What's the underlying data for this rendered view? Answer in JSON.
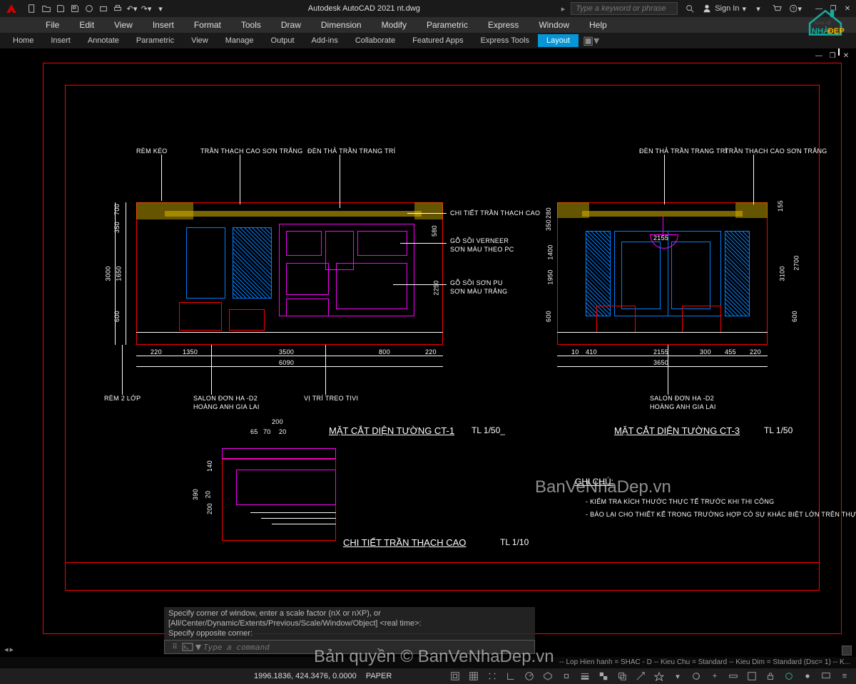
{
  "app": {
    "title": "Autodesk AutoCAD 2021   nt.dwg"
  },
  "search": {
    "placeholder": "Type a keyword or phrase"
  },
  "signin": {
    "label": "Sign In"
  },
  "menu": [
    "File",
    "Edit",
    "View",
    "Insert",
    "Format",
    "Tools",
    "Draw",
    "Dimension",
    "Modify",
    "Parametric",
    "Express",
    "Window",
    "Help"
  ],
  "ribbon": {
    "tabs": [
      "Home",
      "Insert",
      "Annotate",
      "Parametric",
      "View",
      "Manage",
      "Output",
      "Add-ins",
      "Collaborate",
      "Featured Apps",
      "Express Tools",
      "Layout"
    ],
    "active": "Layout"
  },
  "drawing": {
    "labels_top_left": [
      "RÈM KÉO",
      "TRẦN THẠCH CAO SƠN TRẮNG",
      "ĐÈN THẢ TRẦN TRANG TRÍ"
    ],
    "labels_top_right": [
      "ĐÈN THẢ TRẦN TRANG TRÍ",
      "TRẦN THẠCH CAO SƠN TRẮNG"
    ],
    "labels_mid_left": [
      "CHI TIẾT TRẦN THẠCH CAO",
      "GỖ SỒI VERNEER",
      "SƠN MÀU THEO PC",
      "GỖ SỒI SƠN PU",
      "SƠN MÀU TRẮNG"
    ],
    "labels_bot_left": [
      "RÈM 2 LỚP",
      "SALON ĐƠN HA -D2",
      "HOÀNG ANH GIA LAI",
      "VỊ TRÍ TREO TIVI"
    ],
    "labels_bot_right": [
      "SALON ĐƠN HA -D2",
      "HOÀNG ANH GIA LAI"
    ],
    "title1": "MẶT CẮT DIỆN TƯỜNG CT-1",
    "scale1": "TL 1/50_",
    "title3": "MẶT CẮT DIỆN TƯỜNG CT-3",
    "scale3": "TL 1/50",
    "detail_title": "CHI TIẾT TRẦN THẠCH CAO",
    "detail_scale": "TL 1/10",
    "notes_title": "GHI CHÚ:",
    "notes": [
      "- KIỂM TRA KÍCH THƯỚC THỰC TẾ TRƯỚC KHI THI CÔNG",
      "- BÁO LẠI CHO THIẾT KẾ TRONG TRƯỜNG HỢP CÓ SỰ KHÁC BIỆT LỚN TRÊN THỰC TẾ"
    ],
    "dims_left_h": [
      "220",
      "1350",
      "3500",
      "800",
      "220"
    ],
    "dims_left_total": "6090",
    "dims_left_v": [
      "600",
      "1650",
      "350",
      "700"
    ],
    "dims_left_vtotal": "3000",
    "dims_mid_v": [
      "580",
      "2250"
    ],
    "dims_right_h": [
      "10",
      "410",
      "2155",
      "300",
      "455",
      "220"
    ],
    "dims_right_total": "3650",
    "dims_right_v": [
      "600",
      "1950",
      "1400",
      "350",
      "280",
      "155"
    ],
    "dims_right_vtotal": "3100",
    "dims_right_v2": [
      "600",
      "2700"
    ],
    "dims_right_mid": "2155",
    "dims_detail": [
      "200",
      "65",
      "70",
      "20",
      "140",
      "20",
      "200",
      "390"
    ]
  },
  "cmd": {
    "history": [
      "Specify corner of window, enter a scale factor (nX or nXP), or",
      "[All/Center/Dynamic/Extents/Previous/Scale/Window/Object] <real time>:",
      "Specify opposite corner:"
    ],
    "placeholder": "Type a command"
  },
  "status": {
    "coords": "1996.1836, 424.3476, 0.0000",
    "space": "PAPER",
    "layer_line": "-- Lop Hien hanh = SHAC - D -- Kieu Chu = Standard -- Kieu Dim = Standard (Dsc= 1) -- K..."
  },
  "watermark": {
    "t1": "BanVeNhaDep.vn",
    "t2": "Bản quyền © BanVeNhaDep.vn"
  }
}
